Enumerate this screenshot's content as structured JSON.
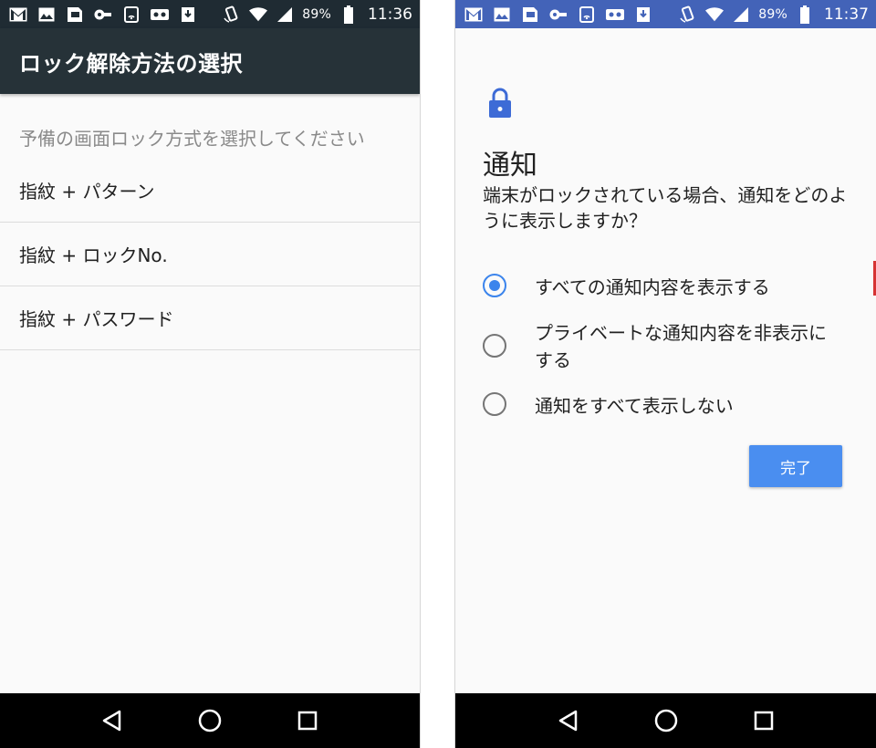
{
  "left_screen": {
    "status_bar": {
      "icons": [
        "gmail-icon",
        "image-icon",
        "sim-card-icon",
        "key-icon",
        "nfc-icon",
        "voicemail-icon",
        "download-icon",
        "vibrate-icon",
        "wifi-icon",
        "signal-icon",
        "battery-icon"
      ],
      "battery": "89%",
      "time": "11:36"
    },
    "app_bar": {
      "title": "ロック解除方法の選択"
    },
    "list_header": "予備の画面ロック方式を選択してください",
    "options": [
      {
        "label": "指紋 + パターン"
      },
      {
        "label": "指紋 + ロックNo."
      },
      {
        "label": "指紋 + パスワード"
      }
    ],
    "nav_bar": {
      "buttons": [
        "back-icon",
        "home-icon",
        "recents-icon"
      ]
    },
    "colors": {
      "status_bar": "#1f2b33",
      "app_bar": "#263238",
      "background": "#fafafa"
    }
  },
  "right_screen": {
    "status_bar": {
      "icons": [
        "gmail-icon",
        "image-icon",
        "sim-card-icon",
        "key-icon",
        "nfc-icon",
        "voicemail-icon",
        "download-icon",
        "vibrate-icon",
        "wifi-icon",
        "signal-icon",
        "battery-icon"
      ],
      "battery": "89%",
      "time": "11:37"
    },
    "header_icon": "lock-icon",
    "title": "通知",
    "question": "端末がロックされている場合、通知をどのように表示しますか？",
    "radio_options": [
      {
        "label": "すべての通知内容を表示する",
        "selected": true
      },
      {
        "label": "プライベートな通知内容を非表示にする",
        "selected": false
      },
      {
        "label": "通知をすべて表示しない",
        "selected": false
      }
    ],
    "done_button": "完了",
    "nav_bar": {
      "buttons": [
        "back-icon",
        "home-icon",
        "recents-icon"
      ]
    },
    "colors": {
      "status_bar": "#4363b8",
      "accent": "#3b84ec",
      "button": "#4a8ef0",
      "lock_icon": "#3d6bd6"
    }
  }
}
